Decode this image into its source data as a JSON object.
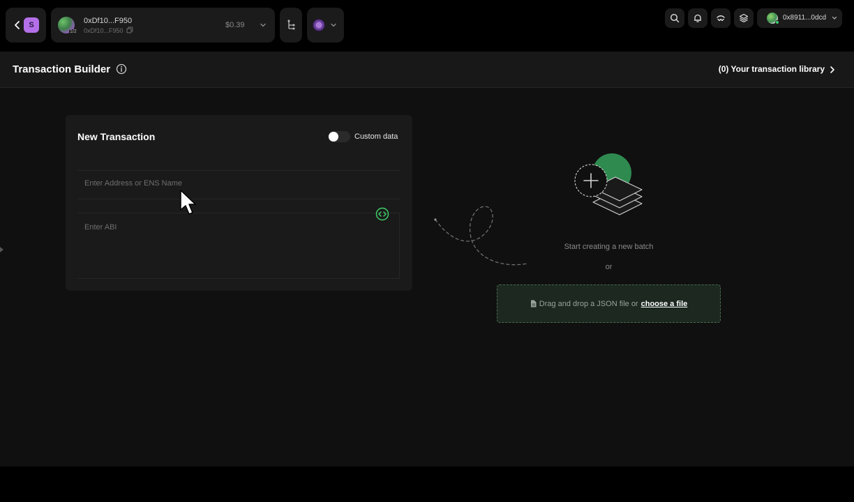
{
  "topbar": {
    "safe_badge": "S",
    "account": {
      "name": "0xDf10...F950",
      "subaddress": "0xDf10...F950",
      "threshold": "1/2",
      "balance": "$0.39"
    },
    "user": {
      "address": "0x8911...0dcd"
    }
  },
  "subheader": {
    "title": "Transaction Builder",
    "library_link": "(0) Your transaction library"
  },
  "card": {
    "title": "New Transaction",
    "toggle_label": "Custom data",
    "toggle_on": false,
    "address_placeholder": "Enter Address or ENS Name",
    "abi_placeholder": "Enter ABI"
  },
  "empty_state": {
    "message": "Start creating a new batch",
    "or": "or",
    "drop_text": "Drag and drop a JSON file or",
    "choose_link": "choose a file"
  },
  "colors": {
    "accent_green": "#3ecf6a",
    "safe_badge": "#b46fe8",
    "background": "#101010",
    "card": "#1a1a1a",
    "dropzone": "#1c2820"
  },
  "icons": [
    "chevron-left-icon",
    "copy-icon",
    "chevron-down-icon",
    "tree-icon",
    "search-icon",
    "bell-icon",
    "walletconnect-icon",
    "layers-icon",
    "info-icon",
    "chevron-right-icon",
    "code-icon",
    "file-icon",
    "plus-icon",
    "cursor-icon"
  ]
}
